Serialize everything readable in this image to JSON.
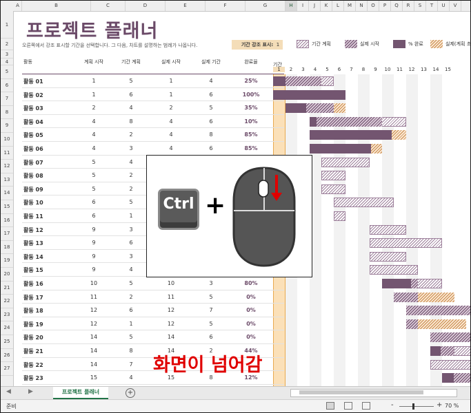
{
  "columns": [
    "A",
    "B",
    "C",
    "D",
    "E",
    "F",
    "G",
    "H",
    "I",
    "J",
    "K",
    "L",
    "M",
    "N",
    "O",
    "P",
    "Q",
    "R",
    "S",
    "T",
    "U",
    "V"
  ],
  "rows": [
    "1",
    "2",
    "3",
    "4",
    "5",
    "6",
    "7",
    "8",
    "9",
    "10",
    "11",
    "12",
    "13",
    "14",
    "15",
    "16",
    "17",
    "18",
    "19",
    "20",
    "21",
    "22",
    "23",
    "24",
    "25",
    "26",
    "27"
  ],
  "header": {
    "title": "프로젝트 플래너",
    "subtitle": "오른쪽에서 강조 표시할 기간을 선택합니다. 그 다음, 차트를 설명하는 범례가 나옵니다.",
    "highlight_label": "기간 강조 표시:",
    "highlight_value": "1"
  },
  "legend": [
    "기간 계획",
    "실제 시작",
    "% 완료",
    "실제(계획 초과)"
  ],
  "table_headers": {
    "activity": "활동",
    "plan_start": "계획 시작",
    "plan_duration": "기간 계획",
    "actual_start": "실제 시작",
    "actual_duration": "실제 기간",
    "percent_complete": "완료율",
    "periods": "기간"
  },
  "period_numbers": [
    "1",
    "2",
    "3",
    "4",
    "5",
    "6",
    "7",
    "8",
    "9",
    "10",
    "11",
    "12",
    "13",
    "14",
    "15"
  ],
  "activities": [
    {
      "name": "활동 01",
      "plan_start": "1",
      "plan_dur": "5",
      "act_start": "1",
      "act_dur": "4",
      "pct": "25%"
    },
    {
      "name": "활동 02",
      "plan_start": "1",
      "plan_dur": "6",
      "act_start": "1",
      "act_dur": "6",
      "pct": "100%"
    },
    {
      "name": "활동 03",
      "plan_start": "2",
      "plan_dur": "4",
      "act_start": "2",
      "act_dur": "5",
      "pct": "35%"
    },
    {
      "name": "활동 04",
      "plan_start": "4",
      "plan_dur": "8",
      "act_start": "4",
      "act_dur": "6",
      "pct": "10%"
    },
    {
      "name": "활동 05",
      "plan_start": "4",
      "plan_dur": "2",
      "act_start": "4",
      "act_dur": "8",
      "pct": "85%"
    },
    {
      "name": "활동 06",
      "plan_start": "4",
      "plan_dur": "3",
      "act_start": "4",
      "act_dur": "6",
      "pct": "85%"
    },
    {
      "name": "활동 07",
      "plan_start": "5",
      "plan_dur": "4",
      "act_start": "",
      "act_dur": "",
      "pct": ""
    },
    {
      "name": "활동 08",
      "plan_start": "5",
      "plan_dur": "2",
      "act_start": "",
      "act_dur": "",
      "pct": ""
    },
    {
      "name": "활동 09",
      "plan_start": "5",
      "plan_dur": "2",
      "act_start": "",
      "act_dur": "",
      "pct": ""
    },
    {
      "name": "활동 10",
      "plan_start": "6",
      "plan_dur": "5",
      "act_start": "",
      "act_dur": "",
      "pct": ""
    },
    {
      "name": "활동 11",
      "plan_start": "6",
      "plan_dur": "1",
      "act_start": "",
      "act_dur": "",
      "pct": ""
    },
    {
      "name": "활동 12",
      "plan_start": "9",
      "plan_dur": "3",
      "act_start": "",
      "act_dur": "",
      "pct": ""
    },
    {
      "name": "활동 13",
      "plan_start": "9",
      "plan_dur": "6",
      "act_start": "",
      "act_dur": "",
      "pct": ""
    },
    {
      "name": "활동 14",
      "plan_start": "9",
      "plan_dur": "3",
      "act_start": "",
      "act_dur": "",
      "pct": ""
    },
    {
      "name": "활동 15",
      "plan_start": "9",
      "plan_dur": "4",
      "act_start": "",
      "act_dur": "",
      "pct": ""
    },
    {
      "name": "활동 16",
      "plan_start": "10",
      "plan_dur": "5",
      "act_start": "10",
      "act_dur": "3",
      "pct": "80%"
    },
    {
      "name": "활동 17",
      "plan_start": "11",
      "plan_dur": "2",
      "act_start": "11",
      "act_dur": "5",
      "pct": "0%"
    },
    {
      "name": "활동 18",
      "plan_start": "12",
      "plan_dur": "6",
      "act_start": "12",
      "act_dur": "7",
      "pct": "0%"
    },
    {
      "name": "활동 19",
      "plan_start": "12",
      "plan_dur": "1",
      "act_start": "12",
      "act_dur": "5",
      "pct": "0%"
    },
    {
      "name": "활동 20",
      "plan_start": "14",
      "plan_dur": "5",
      "act_start": "14",
      "act_dur": "6",
      "pct": "0%"
    },
    {
      "name": "활동 21",
      "plan_start": "14",
      "plan_dur": "8",
      "act_start": "14",
      "act_dur": "2",
      "pct": "44%"
    },
    {
      "name": "활동 22",
      "plan_start": "14",
      "plan_dur": "7",
      "act_start": "",
      "act_dur": "",
      "pct": ""
    },
    {
      "name": "활동 23",
      "plan_start": "15",
      "plan_dur": "4",
      "act_start": "15",
      "act_dur": "8",
      "pct": "12%"
    }
  ],
  "overlay": {
    "ctrl_key": "Ctrl",
    "plus": "+",
    "note": "화면이 넘어감"
  },
  "sheet_tab": "프로젝트 플래너",
  "add_sheet": "+",
  "status": {
    "ready": "준비",
    "zoom_minus": "-",
    "zoom_plus": "+",
    "zoom": "70 %"
  },
  "colors": {
    "plan": "#9c7f9a",
    "actual": "#6b4a68",
    "complete": "#735570",
    "over": "#c78a4a",
    "highlight": "#f4ddb8",
    "gold": "#e8a94f"
  }
}
